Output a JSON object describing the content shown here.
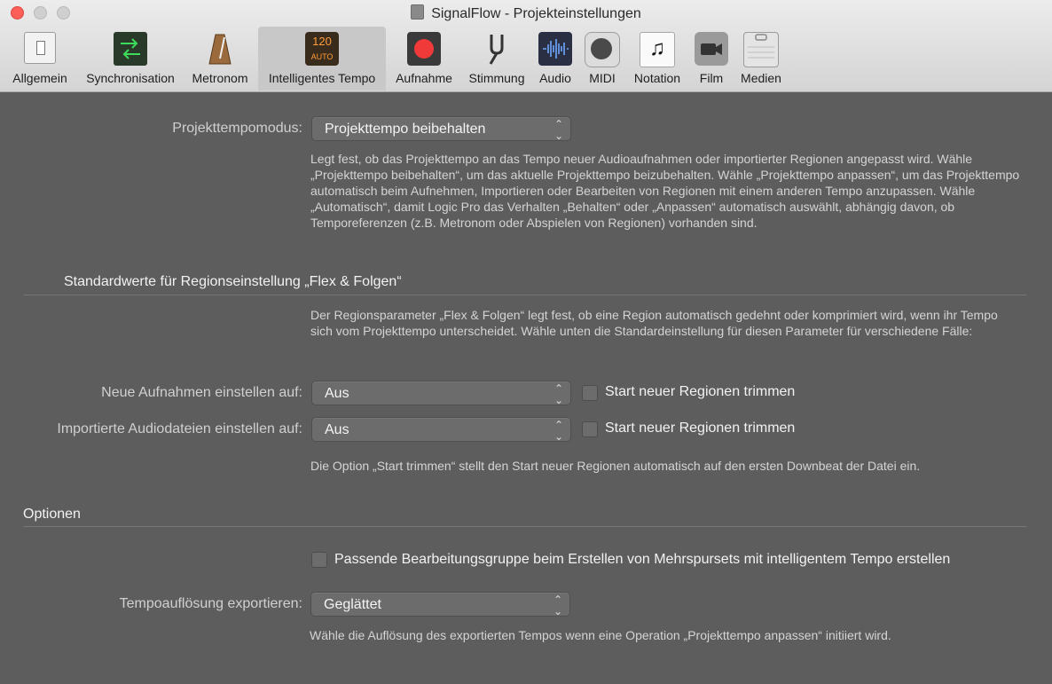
{
  "window": {
    "title": "SignalFlow - Projekteinstellungen"
  },
  "tabs": [
    {
      "label": "Allgemein",
      "icon": "switch-icon"
    },
    {
      "label": "Synchronisation",
      "icon": "sync-arrows-icon"
    },
    {
      "label": "Metronom",
      "icon": "metronome-icon"
    },
    {
      "label": "Intelligentes Tempo",
      "icon": "tempo-icon",
      "icon_text_top": "120",
      "icon_text_bottom": "AUTO",
      "active": true
    },
    {
      "label": "Aufnahme",
      "icon": "record-icon"
    },
    {
      "label": "Stimmung",
      "icon": "tuning-fork-icon"
    },
    {
      "label": "Audio",
      "icon": "waveform-icon"
    },
    {
      "label": "MIDI",
      "icon": "midi-port-icon"
    },
    {
      "label": "Notation",
      "icon": "music-note-icon",
      "glyph": "♫"
    },
    {
      "label": "Film",
      "icon": "camera-icon"
    },
    {
      "label": "Medien",
      "icon": "media-briefcase-icon"
    }
  ],
  "tempo_mode": {
    "label": "Projekttempomodus:",
    "value": "Projekttempo beibehalten",
    "description": "Legt fest, ob das Projekttempo an das Tempo neuer Audioaufnahmen oder importierter Regionen angepasst wird. Wähle „Projekttempo beibehalten“, um das aktuelle Projekttempo beizubehalten. Wähle „Projekttempo anpassen“, um das Projekttempo automatisch beim Aufnehmen, Importieren oder Bearbeiten von Regionen mit einem anderen Tempo anzupassen. Wähle „Automatisch“, damit Logic Pro das Verhalten „Behalten“ oder „Anpassen“ automatisch auswählt, abhängig davon, ob Temporeferenzen (z.B. Metronom oder Abspielen von Regionen) vorhanden sind."
  },
  "flex_section": {
    "title": "Standardwerte für Regionseinstellung „Flex & Folgen“",
    "description": "Der Regionsparameter „Flex & Folgen“ legt fest, ob eine Region automatisch gedehnt oder komprimiert wird, wenn ihr Tempo sich vom Projekttempo unterscheidet. Wähle unten die Standardeinstellung für diesen Parameter für verschiedene Fälle:",
    "new_recordings": {
      "label": "Neue Aufnahmen einstellen auf:",
      "value": "Aus",
      "checkbox_label": "Start neuer Regionen trimmen",
      "checked": false
    },
    "imported_audio": {
      "label": "Importierte Audiodateien einstellen auf:",
      "value": "Aus",
      "checkbox_label": "Start neuer Regionen trimmen",
      "checked": false
    },
    "trim_note": "Die Option „Start trimmen“ stellt den Start neuer Regionen automatisch auf den ersten Downbeat der Datei ein."
  },
  "options_section": {
    "title": "Optionen",
    "edit_group": {
      "label": "Passende Bearbeitungsgruppe beim Erstellen von Mehrspursets mit intelligentem Tempo erstellen",
      "checked": false
    },
    "export_resolution": {
      "label": "Tempoauflösung exportieren:",
      "value": "Geglättet"
    },
    "export_note": "Wähle die Auflösung des exportierten Tempos wenn eine Operation „Projekttempo anpassen“ initiiert wird."
  },
  "colors": {
    "background": "#5d5d5d",
    "toolbar": "#dcdcdc",
    "accent_record": "#f03a3a",
    "tempo_icon_text": "#ff9c3a"
  }
}
